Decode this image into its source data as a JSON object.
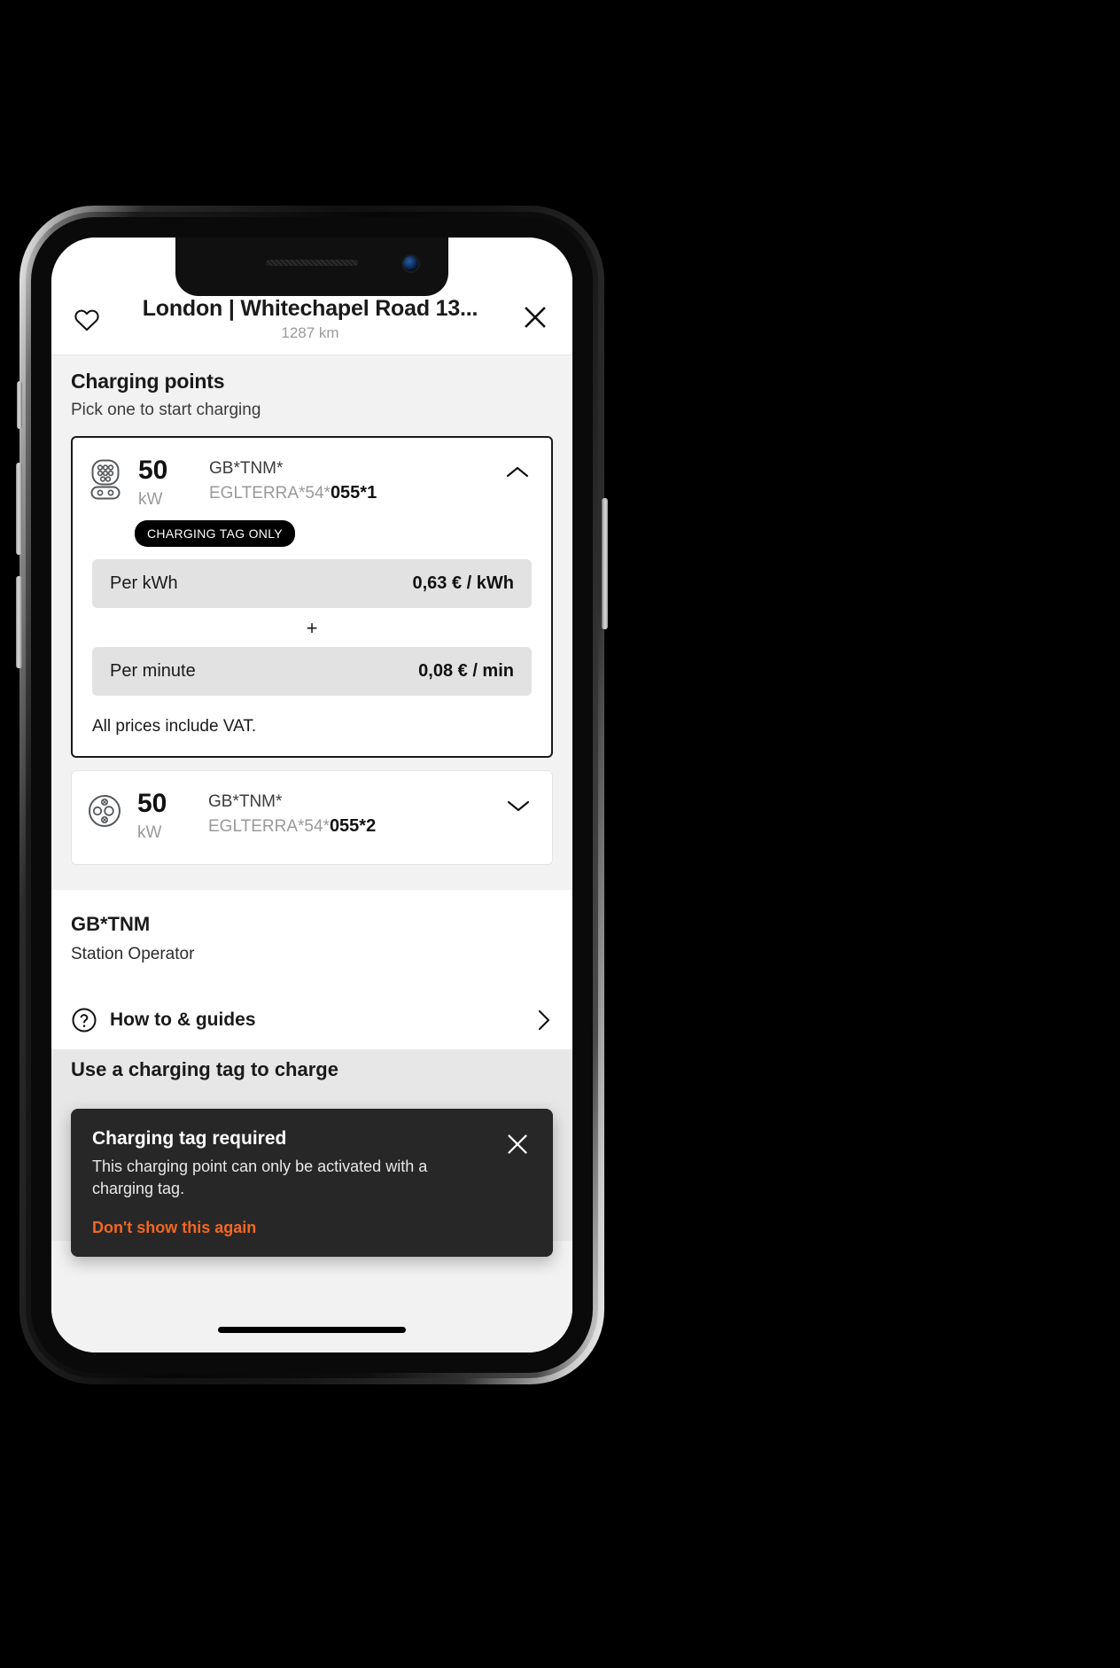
{
  "header": {
    "favorite_icon": "heart-icon",
    "title": "London | Whitechapel Road 13...",
    "distance": "1287 km",
    "close_icon": "close-icon"
  },
  "charging_points_section": {
    "title": "Charging points",
    "subtitle": "Pick one to start charging"
  },
  "charging_points": [
    {
      "connector_icon": "ccs-connector-icon",
      "power": "50",
      "power_unit": "kW",
      "operator_prefix": "GB*TNM*",
      "evse_id_prefix": "EGLTERRA*54*",
      "evse_id_suffix": "055*1",
      "expanded": true,
      "chevron_icon": "chevron-up-icon",
      "badge": "CHARGING TAG ONLY",
      "prices": [
        {
          "label": "Per kWh",
          "value": "0,63 € / kWh"
        },
        {
          "label": "Per minute",
          "value": "0,08 € / min"
        }
      ],
      "price_operator": "+",
      "vat_note": "All prices include VAT."
    },
    {
      "connector_icon": "chademo-connector-icon",
      "power": "50",
      "power_unit": "kW",
      "operator_prefix": "GB*TNM*",
      "evse_id_prefix": "EGLTERRA*54*",
      "evse_id_suffix": "055*2",
      "expanded": false,
      "chevron_icon": "chevron-down-icon"
    }
  ],
  "operator": {
    "name": "GB*TNM",
    "role": "Station Operator"
  },
  "guides": {
    "icon": "question-circle-icon",
    "label": "How to & guides",
    "chevron_icon": "chevron-right-icon"
  },
  "tag_cta": {
    "label": "Use a charging tag to charge"
  },
  "toast": {
    "title": "Charging tag required",
    "text": "This charging point can only be activated with a charging tag.",
    "link": "Don't show this again",
    "close_icon": "close-icon",
    "background": "#272727",
    "link_color": "#f26722"
  }
}
